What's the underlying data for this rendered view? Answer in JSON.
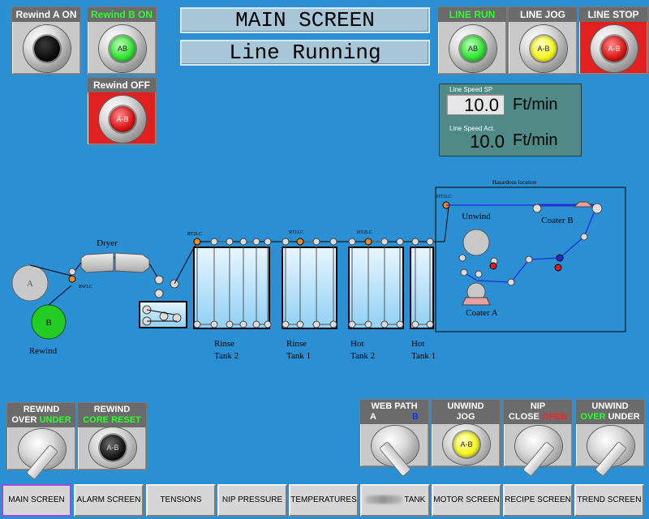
{
  "title": {
    "screen": "MAIN SCREEN",
    "status": "Line Running"
  },
  "rewind_buttons": {
    "rewind_a_on": "Rewind A ON",
    "rewind_b_on": "Rewind B ON",
    "rewind_off": "Rewind OFF",
    "cap_b_on": "AB",
    "cap_off": "A-B"
  },
  "line_buttons": {
    "line_run": "LINE RUN",
    "line_jog": "LINE JOG",
    "line_stop": "LINE STOP",
    "cap_run": "AB",
    "cap_jog": "A-B",
    "cap_stop": "A-B"
  },
  "speed": {
    "sp_label": "Line Speed SP",
    "sp_value": "10.0",
    "act_label": "Line Speed Act.",
    "act_value": "10.0",
    "unit": "Ft/min"
  },
  "diagram": {
    "hazard_title": "Hazardous location",
    "dryer": "Dryer",
    "roll_a": "A",
    "roll_b": "B",
    "rewind": "Rewind",
    "rwlc": "RWLC",
    "rt2lc": "RT2LC",
    "rt1lc": "RT1LC",
    "ht2lc": "HT2LC",
    "ht1lc": "HT1LC",
    "unwind": "Unwind",
    "coater_a": "Coater A",
    "coater_b": "Coater B",
    "tanks": [
      {
        "line1": "Rinse",
        "line2": "Tank 2"
      },
      {
        "line1": "Rinse",
        "line2": "Tank 1"
      },
      {
        "line1": "Hot",
        "line2": "Tank 2"
      },
      {
        "line1": "Hot",
        "line2": "Tank 1"
      }
    ]
  },
  "controls": {
    "rewind_over": "REWIND",
    "rewind_over_l2a": "OVER",
    "rewind_over_l2b": "UNDER",
    "rewind_core": "REWIND",
    "rewind_core_l2": "CORE RESET",
    "core_cap": "A-B",
    "web_path": "WEB PATH",
    "web_a": "A",
    "web_b": "B",
    "unwind_jog": "UNWIND",
    "unwind_jog_l2": "JOG",
    "jog_cap": "A-B",
    "nip": "NIP",
    "nip_close": "CLOSE",
    "nip_open": "OPEN",
    "unwind_ou": "UNWIND",
    "unwind_over": "OVER",
    "unwind_under": "UNDER"
  },
  "nav": [
    {
      "label": "MAIN SCREEN"
    },
    {
      "label": "ALARM SCREEN"
    },
    {
      "label": "TENSIONS"
    },
    {
      "label": "NIP PRESSURE"
    },
    {
      "label": "TEMPERATURES"
    },
    {
      "label": "TANK"
    },
    {
      "label": "MOTOR SCREEN"
    },
    {
      "label": "RECIPE SCREEN"
    },
    {
      "label": "TREND SCREEN"
    }
  ],
  "colors": {
    "background": "#2b8fd4",
    "indicator_green": "#2bff2b",
    "stop_red": "#e32020",
    "sensor_orange": "#f08a24"
  }
}
